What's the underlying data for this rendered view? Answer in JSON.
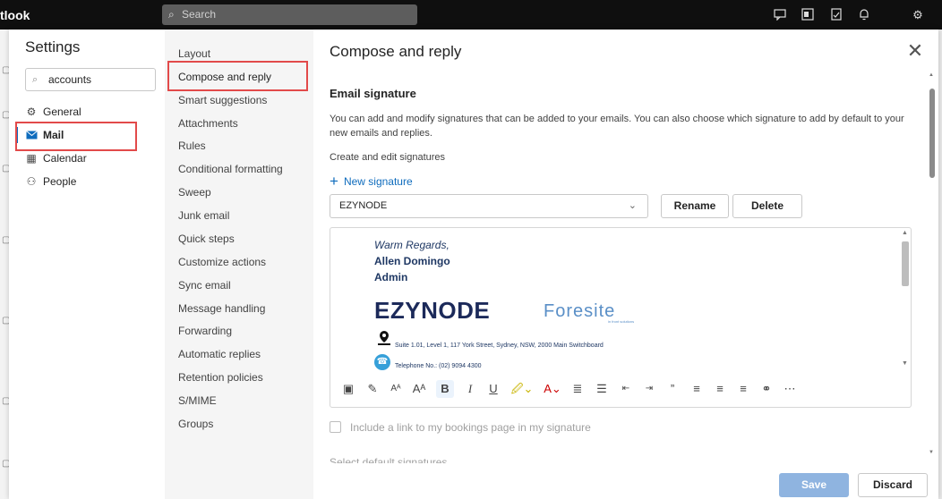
{
  "app": {
    "title": "tlook"
  },
  "top_search": {
    "placeholder": "Search"
  },
  "settings": {
    "title": "Settings",
    "search_value": "accounts",
    "nav": [
      {
        "label": "General",
        "icon": "gear-icon"
      },
      {
        "label": "Mail",
        "icon": "mail-icon",
        "selected": true
      },
      {
        "label": "Calendar",
        "icon": "calendar-icon"
      },
      {
        "label": "People",
        "icon": "people-icon"
      }
    ]
  },
  "mail_nav": [
    "Layout",
    "Compose and reply",
    "Smart suggestions",
    "Attachments",
    "Rules",
    "Conditional formatting",
    "Sweep",
    "Junk email",
    "Quick steps",
    "Customize actions",
    "Sync email",
    "Message handling",
    "Forwarding",
    "Automatic replies",
    "Retention policies",
    "S/MIME",
    "Groups"
  ],
  "compose": {
    "title": "Compose and reply",
    "section_title": "Email signature",
    "description": "You can add and modify signatures that can be added to your emails. You can also choose which signature to add by default to your new emails and replies.",
    "create_label": "Create and edit signatures",
    "new_signature": "New signature",
    "selected_signature": "EZYNODE",
    "rename": "Rename",
    "delete": "Delete",
    "signature": {
      "greeting": "Warm Regards,",
      "name": "Allen Domingo",
      "role": "Admin",
      "logo_left": "EZYNODE",
      "logo_right": "Foresite",
      "logo_right_tagline": "in front solutions",
      "address": "Suite 1.01, Level 1, 117 York Street, Sydney, NSW, 2000 Main Switchboard",
      "phone": "Telephone No.: (02) 9094 4300"
    },
    "bookings_label": "Include a link to my bookings page in my signature",
    "default_sig_label": "Select default signatures",
    "save": "Save",
    "discard": "Discard"
  },
  "colors": {
    "accent": "#0f6cbd",
    "highlight": "#e24a4a",
    "save_disabled": "#8fb4e0"
  }
}
